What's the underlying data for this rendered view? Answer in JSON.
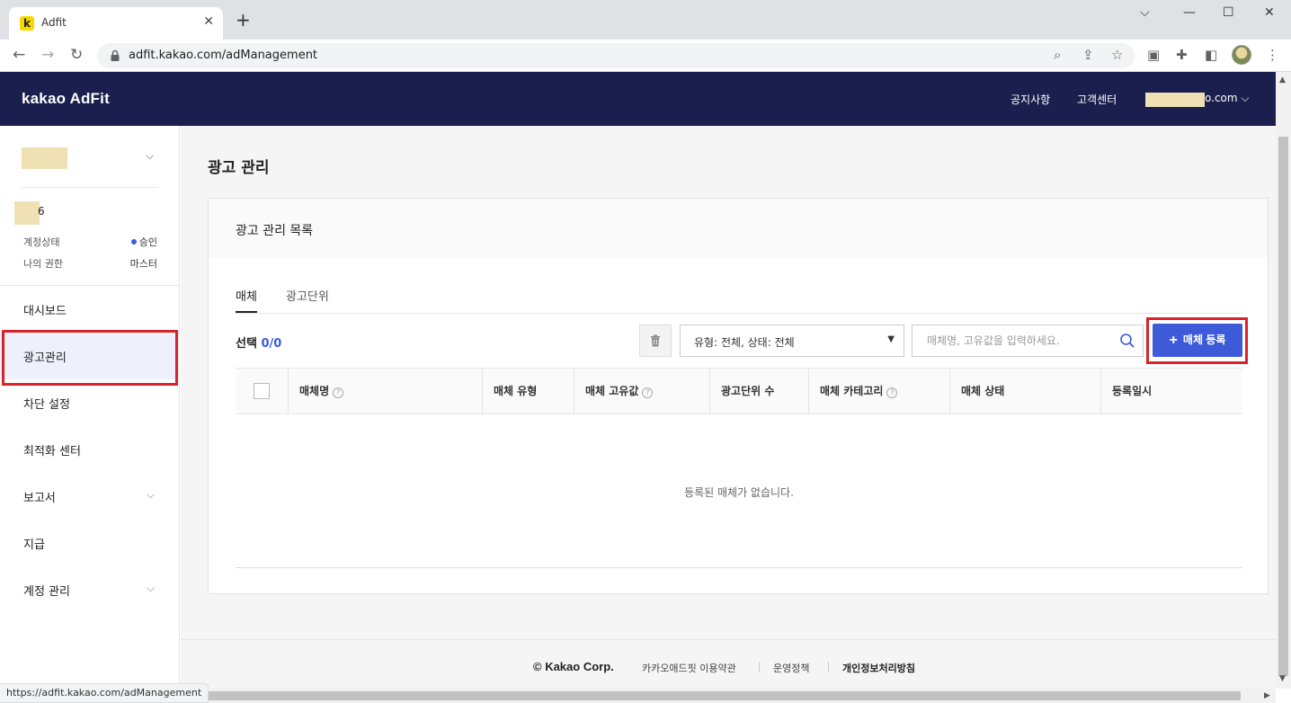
{
  "browser": {
    "tab_title": "Adfit",
    "favicon_letter": "k",
    "new_tab": "+",
    "url": "adfit.kakao.com/adManagement",
    "status_url": "https://adfit.kakao.com/adManagement"
  },
  "header": {
    "logo": "kakao AdFit",
    "notice": "공지사항",
    "support": "고객센터",
    "email_suffix": "o.com ⌵"
  },
  "sidebar": {
    "account_number_suffix": "6",
    "account_status_label": "계정상태",
    "account_status_value": "승인",
    "role_label": "나의 권한",
    "role_value": "마스터",
    "items": [
      {
        "label": "대시보드"
      },
      {
        "label": "광고관리"
      },
      {
        "label": "차단 설정"
      },
      {
        "label": "최적화 센터"
      },
      {
        "label": "보고서"
      },
      {
        "label": "지급"
      },
      {
        "label": "계정 관리"
      }
    ]
  },
  "main": {
    "page_title": "광고 관리",
    "card_title": "광고 관리 목록",
    "tabs": [
      "매체",
      "광고단위"
    ],
    "selection_label": "선택",
    "selection_value": "0/0",
    "filter_select": "유형: 전체, 상태: 전체",
    "search_placeholder": "매체명, 고유값을 입력하세요.",
    "register_button": "매체 등록",
    "columns": [
      "매체명",
      "매체 유형",
      "매체 고유값",
      "광고단위 수",
      "매체 카테고리",
      "매체 상태",
      "등록일시"
    ],
    "empty_message": "등록된 매체가 없습니다."
  },
  "footer": {
    "copyright": "© Kakao Corp.",
    "links": [
      "카카오애드핏 이용약관",
      "운영정책",
      "개인정보처리방침"
    ]
  },
  "colors": {
    "header_bg": "#1b1f4d",
    "accent": "#3d5bd9",
    "highlight": "#d8232a"
  }
}
